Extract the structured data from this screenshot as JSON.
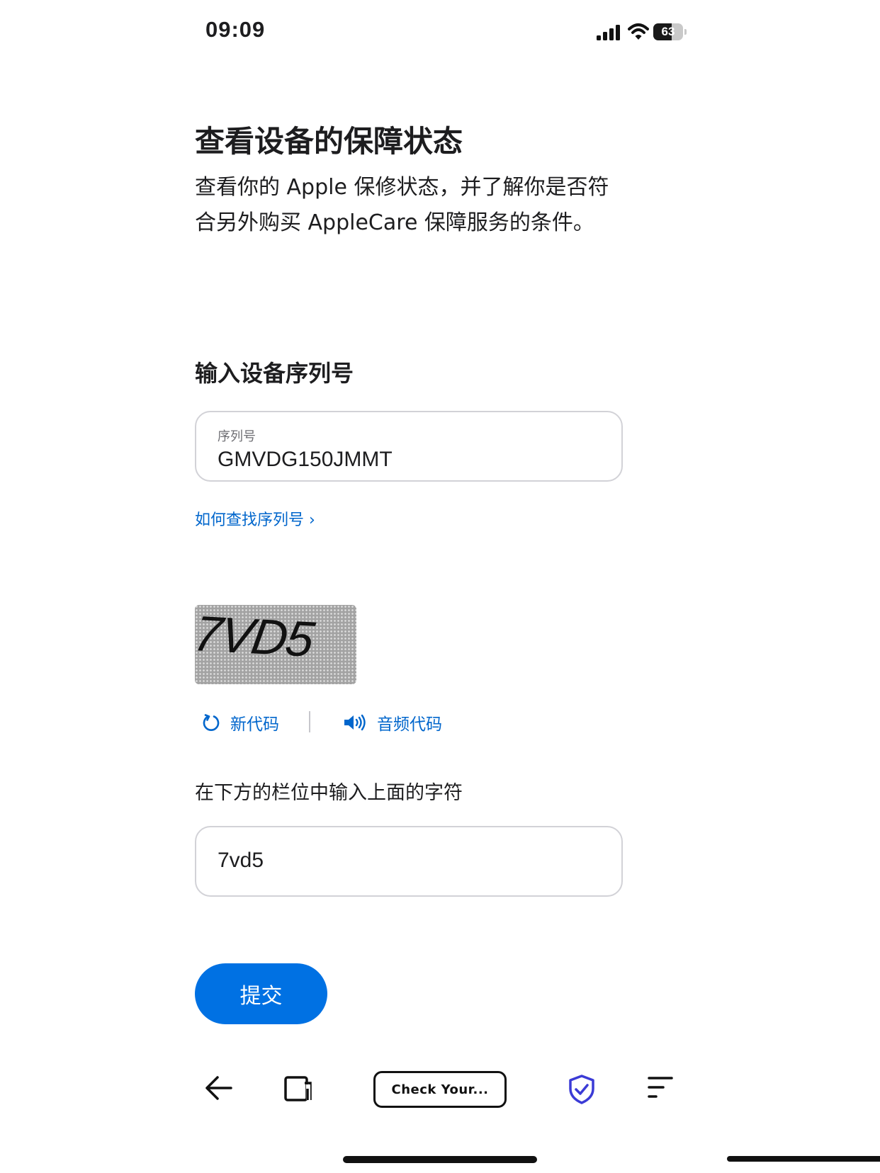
{
  "status_bar": {
    "time": "09:09",
    "battery": "63",
    "battery_level": 0.63
  },
  "page": {
    "title": "查看设备的保障状态",
    "description": "查看你的 Apple 保修状态，并了解你是否符合另外购买 AppleCare 保障服务的条件。"
  },
  "serial_section": {
    "heading": "输入设备序列号",
    "field_label": "序列号",
    "field_value": "GMVDG150JMMT",
    "help_link": "如何查找序列号 ›"
  },
  "captcha": {
    "image_text": "7VD5",
    "refresh_label": "新代码",
    "audio_label": "音频代码",
    "instruction": "在下方的栏位中输入上面的字符",
    "input_value": "7vd5"
  },
  "submit_label": "提交",
  "toolbar": {
    "url_label": "Check Your..."
  },
  "colors": {
    "accent": "#0071e3",
    "link": "#0066cc",
    "border": "#d2d2d7",
    "shield": "#3b3bd6"
  }
}
